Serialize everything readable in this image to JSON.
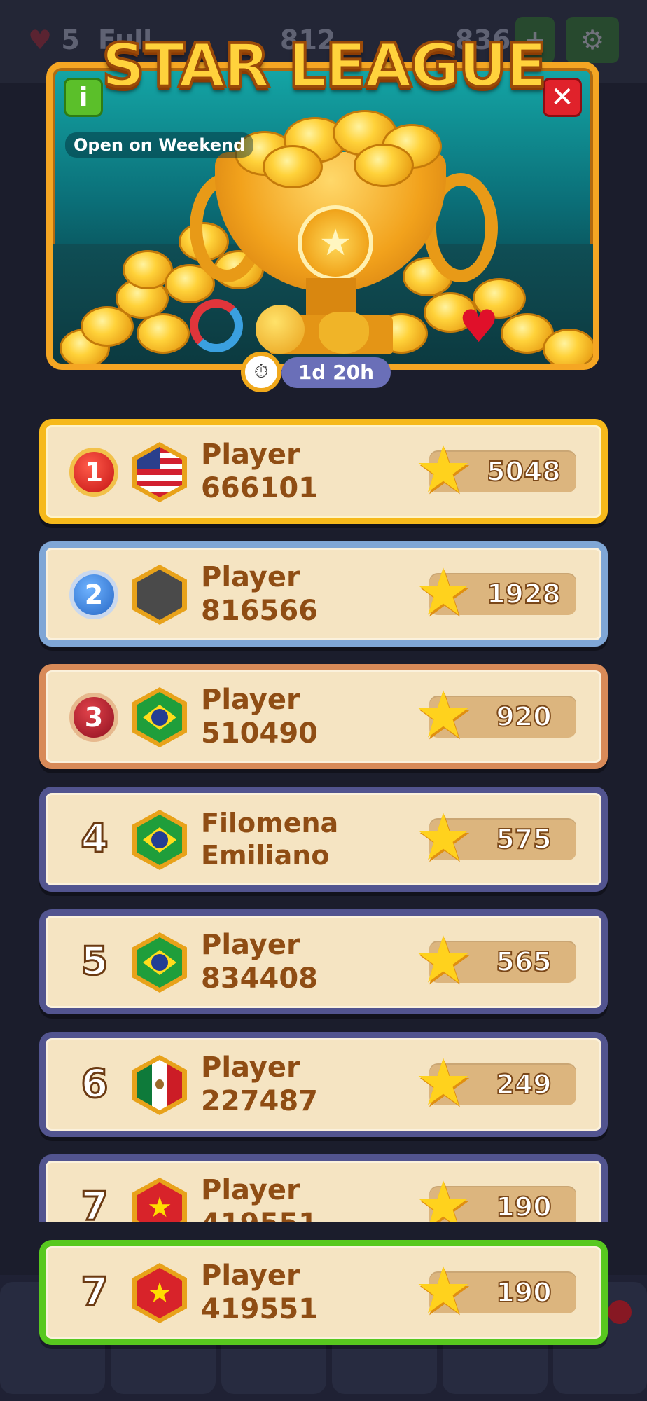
{
  "hud": {
    "lives": "5",
    "lives_status": "Full",
    "stars": "812",
    "coins": "836"
  },
  "banner": {
    "title": "STAR LEAGUE",
    "info_label": "i",
    "close_label": "✕",
    "subtitle": "Open on Weekend",
    "timer": "1d 20h",
    "colors": {
      "frame": "#f5a623",
      "teal": "#0b6f78",
      "close": "#e0222b",
      "info": "#5bbf2a"
    }
  },
  "leaderboard": {
    "rows": [
      {
        "rank": "1",
        "medal": true,
        "flag": "us",
        "name": "Player 666101",
        "score": "5048"
      },
      {
        "rank": "2",
        "medal": true,
        "flag": "none",
        "name": "Player 816566",
        "score": "1928"
      },
      {
        "rank": "3",
        "medal": true,
        "flag": "br",
        "name": "Player 510490",
        "score": "920"
      },
      {
        "rank": "4",
        "medal": false,
        "flag": "br",
        "name": "Filomena Emiliano",
        "score": "575"
      },
      {
        "rank": "5",
        "medal": false,
        "flag": "br",
        "name": "Player 834408",
        "score": "565"
      },
      {
        "rank": "6",
        "medal": false,
        "flag": "mx",
        "name": "Player 227487",
        "score": "249"
      },
      {
        "rank": "7",
        "medal": false,
        "flag": "vn",
        "name": "Player 419551",
        "score": "190"
      }
    ],
    "current_player": {
      "rank": "7",
      "flag": "vn",
      "name": "Player 419551",
      "score": "190"
    },
    "colors": {
      "gold": "#f6b91b",
      "silver": "#7fa6d6",
      "bronze": "#d88a58",
      "default": "#52548f",
      "me": "#58c81f",
      "card": "#f5e4c2"
    }
  }
}
